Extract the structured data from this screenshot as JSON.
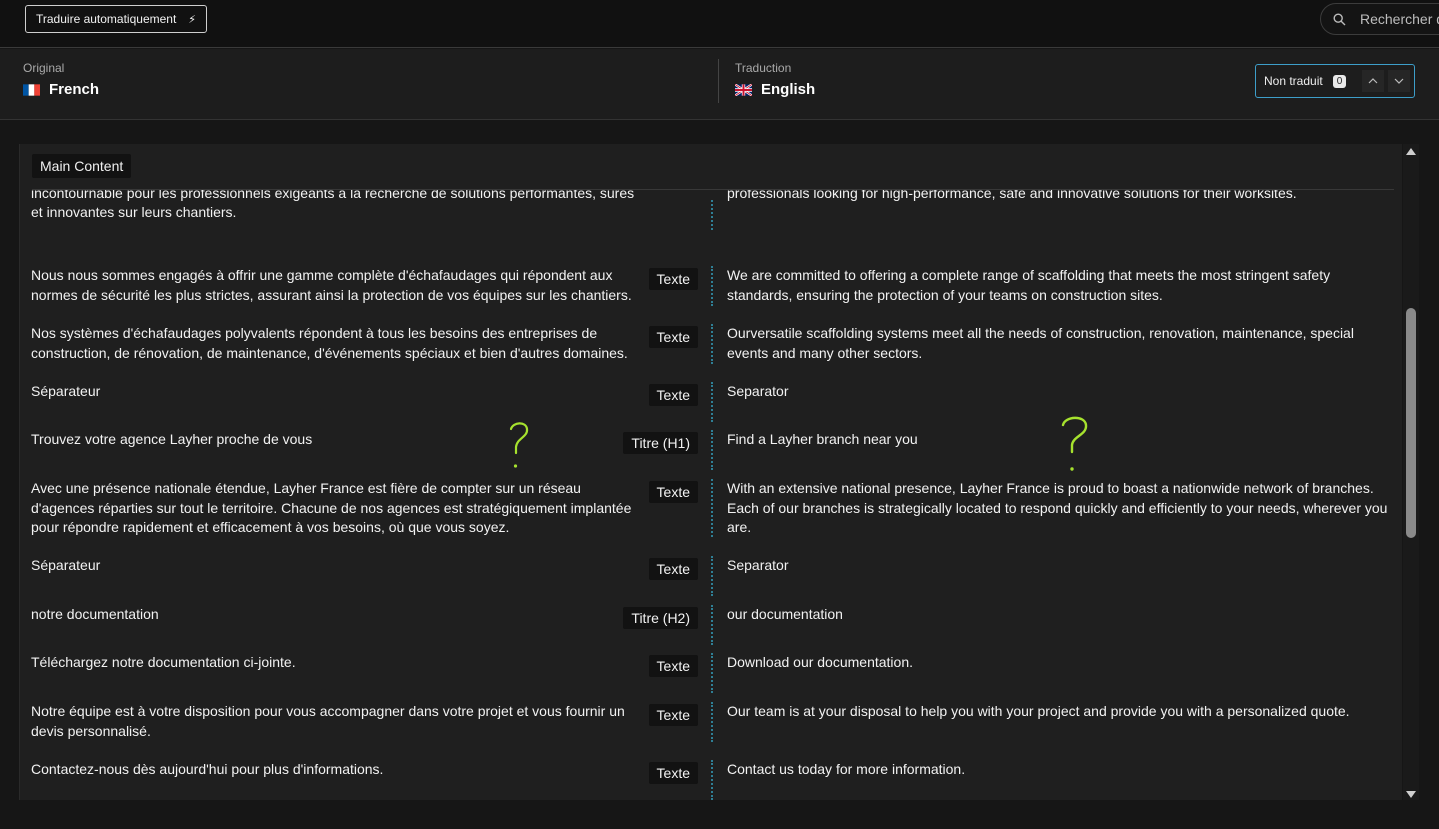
{
  "toolbar": {
    "auto_translate_label": "Traduire automatiquement",
    "bolt_icon": "lightning-icon",
    "search_placeholder": "Rechercher d"
  },
  "languages": {
    "original_label": "Original",
    "original_name": "French",
    "original_flag": "flag-fr-icon",
    "translation_label": "Traduction",
    "translation_name": "English",
    "translation_flag": "flag-gb-icon"
  },
  "filter": {
    "label": "Non traduit",
    "count": "0"
  },
  "section": {
    "title": "Main Content"
  },
  "rows": [
    {
      "source": "Forte de plusieurs décennies d'expérience, Layher France est devenue une référence incontournable pour les professionnels exigeants à la recherche de solutions performantes, sûres et innovantes sur leurs chantiers.",
      "type": "Texte",
      "target": "With decades of experience behind it, Layher France has become a benchmark for demanding professionals looking for high-performance, safe and innovative solutions for their worksites."
    },
    {
      "source": "Nous nous sommes engagés à offrir une gamme complète d'échafaudages qui répondent aux normes de sécurité les plus strictes, assurant ainsi la protection de vos équipes sur les chantiers.",
      "type": "Texte",
      "target": "We are committed to offering a complete range of scaffolding that meets the most stringent safety standards, ensuring the protection of your teams on construction sites."
    },
    {
      "source": "Nos systèmes d'échafaudages polyvalents répondent à tous les besoins des entreprises de construction, de rénovation, de maintenance, d'événements spéciaux et bien d'autres domaines.",
      "type": "Texte",
      "target": "Ourversatile scaffolding systems meet all the needs of construction, renovation, maintenance, special events and many other sectors."
    },
    {
      "source": "Séparateur",
      "type": "Texte",
      "target": "Separator"
    },
    {
      "source": "Trouvez votre agence Layher proche de vous",
      "type": "Titre (H1)",
      "target": "Find a Layher branch near you"
    },
    {
      "source": "Avec une présence nationale étendue, Layher France est fière de compter sur un réseau d'agences réparties sur tout le territoire. Chacune de nos agences est stratégiquement implantée pour répondre rapidement et efficacement à vos besoins, où que vous soyez.",
      "type": "Texte",
      "target": "With an extensive national presence, Layher France is proud to boast a nationwide network of branches. Each of our branches is strategically located to respond quickly and efficiently to your needs, wherever you are."
    },
    {
      "source": "Séparateur",
      "type": "Texte",
      "target": "Separator"
    },
    {
      "source": "notre documentation",
      "type": "Titre (H2)",
      "target": "our documentation"
    },
    {
      "source": "Téléchargez notre documentation ci-jointe.",
      "type": "Texte",
      "target": "Download our documentation."
    },
    {
      "source": "Notre équipe est à votre disposition pour vous accompagner dans votre projet et vous fournir un devis personnalisé.",
      "type": "Texte",
      "target": "Our team is at your disposal to help you with your project and provide you with a personalized quote."
    },
    {
      "source": "Contactez-nous dès aujourd'hui pour plus d'informations.",
      "type": "Texte",
      "target": "Contact us today for more information."
    }
  ],
  "colors": {
    "accent": "#3d9ec9",
    "dotted_divider": "#2f7f95",
    "annotation": "#a6e22e"
  }
}
